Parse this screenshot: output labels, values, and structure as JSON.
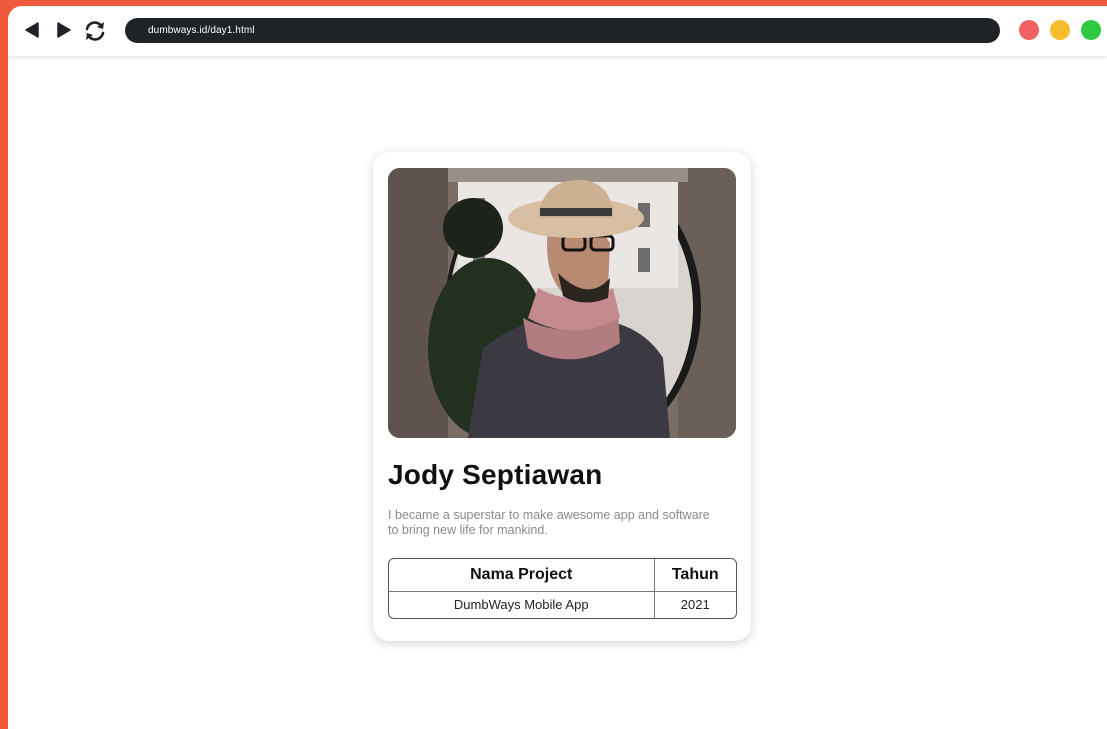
{
  "browser": {
    "url": "dumbways.id/day1.html",
    "icons": [
      "back-arrow-icon",
      "forward-arrow-icon",
      "reload-icon"
    ],
    "window_controls": [
      {
        "name": "close",
        "color": "#F26161"
      },
      {
        "name": "minimize",
        "color": "#F6BD2C"
      },
      {
        "name": "maximize",
        "color": "#2FC941"
      }
    ]
  },
  "colors": {
    "page_background": "#F05A3C",
    "address_bar": "#1F2328"
  },
  "profile": {
    "name": "Jody Septiawan",
    "bio": "I became a superstar to make awesome app and software to bring new life for mankind."
  },
  "projects": {
    "headers": [
      "Nama Project",
      "Tahun"
    ],
    "rows": [
      [
        "DumbWays Mobile App",
        "2021"
      ]
    ]
  }
}
